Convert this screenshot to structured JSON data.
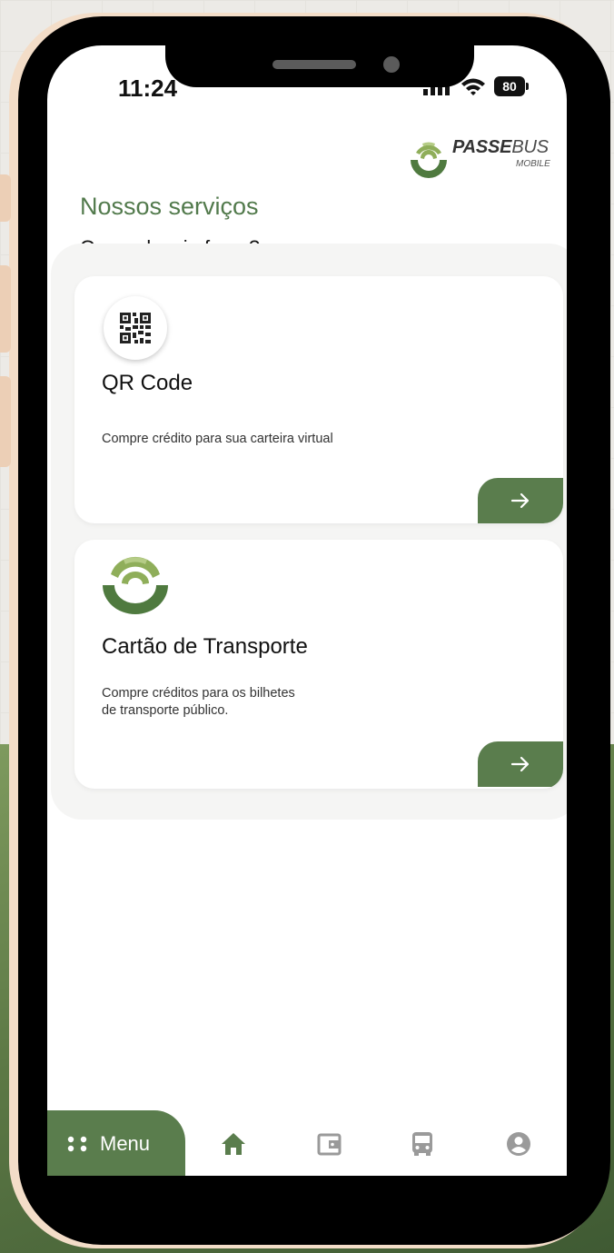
{
  "status_bar": {
    "time": "11:24",
    "battery": "80"
  },
  "logo": {
    "name_bold": "PASSE",
    "name_regular": "BUS",
    "subtitle": "MOBILE"
  },
  "header": {
    "title": "Nossos serviços",
    "subtitle": "O que deseja fazer?"
  },
  "cards": [
    {
      "title": "QR Code",
      "description": "Compre crédito para sua carteira virtual",
      "icon": "qr-code-icon",
      "action_icon": "arrow-right-icon"
    },
    {
      "title": "Cartão de Transporte",
      "description_line1": "Compre créditos para os bilhetes",
      "description_line2": "de transporte público.",
      "icon": "passebus-logo-icon",
      "action_icon": "arrow-right-icon"
    }
  ],
  "nav": {
    "menu_label": "Menu",
    "items": [
      "home-icon",
      "wallet-icon",
      "bus-icon",
      "account-icon"
    ]
  },
  "colors": {
    "accent": "#5a7d4d",
    "title_green": "#527a4c",
    "frame": "#f3ddc8"
  }
}
